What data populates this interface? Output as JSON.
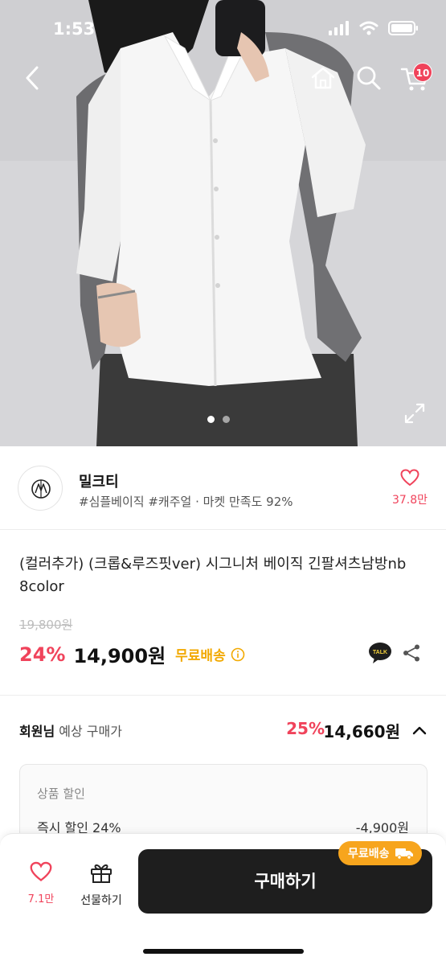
{
  "status_bar": {
    "time": "1:53"
  },
  "cart": {
    "badge_count": "10"
  },
  "gallery": {
    "total_pages": 2,
    "current_page": 1
  },
  "shop": {
    "name": "밀크티",
    "tags": "#심플베이직 #캐주얼 · 마켓 만족도 92%",
    "like_count": "37.8만"
  },
  "product": {
    "title": "(컬러추가) (크롭&루즈핏ver) 시그니처 베이직 긴팔셔츠남방nb 8color",
    "original_price": "19,800원",
    "discount_rate": "24%",
    "price": "14,900원",
    "shipping_label": "무료배송"
  },
  "member_price": {
    "label_bold": "회원님",
    "label_rest": " 예상 구매가",
    "discount_rate": "25%",
    "price": "14,660원"
  },
  "discount_detail": {
    "section_title": "상품 할인",
    "line_label": "즉시 할인 24%",
    "line_value": "-4,900원"
  },
  "bottom_bar": {
    "like_count": "7.1만",
    "gift_label": "선물하기",
    "buy_label": "구매하기",
    "ship_badge": "무료배송"
  },
  "colors": {
    "accent_red": "#f0435b",
    "shipping_yellow": "#f2a900",
    "buy_button": "#1e1e1e",
    "badge_orange": "#f7a51d"
  },
  "icons": [
    "back-icon",
    "home-icon",
    "search-icon",
    "cart-icon",
    "expand-icon",
    "heart-icon",
    "info-icon",
    "kakao-talk-icon",
    "share-icon",
    "chevron-up-icon",
    "gift-icon",
    "truck-icon"
  ]
}
